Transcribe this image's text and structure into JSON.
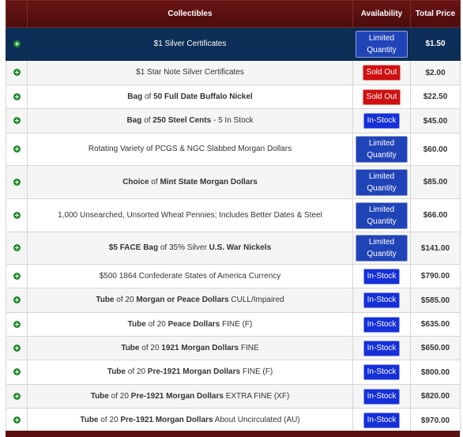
{
  "colors": {
    "header_bg": "#5b1010",
    "highlight_row": "#0d2e57",
    "plus_icon": "#1f8a2a",
    "limited_badge": "#2044b8",
    "sold_out_badge": "#d01010",
    "in_stock_badge": "#1530d8"
  },
  "table": {
    "headers": {
      "collectibles": "Collectibles",
      "availability": "Availability",
      "total_price": "Total Price"
    },
    "rows": [
      {
        "parts": [
          {
            "t": "$1 Silver Certificates",
            "b": false
          }
        ],
        "status": "Limited Quantity",
        "kind": "lim",
        "price": "$1.50",
        "hl": true
      },
      {
        "parts": [
          {
            "t": "$1 Star Note Silver Certificates",
            "b": false
          }
        ],
        "status": "Sold Out",
        "kind": "sold",
        "price": "$2.00"
      },
      {
        "parts": [
          {
            "t": "Bag",
            "b": true
          },
          {
            "t": " of ",
            "b": false
          },
          {
            "t": "50 Full Date Buffalo Nickel",
            "b": true
          }
        ],
        "status": "Sold Out",
        "kind": "sold",
        "price": "$22.50"
      },
      {
        "parts": [
          {
            "t": "Bag",
            "b": true
          },
          {
            "t": " of ",
            "b": false
          },
          {
            "t": "250 Steel Cents",
            "b": true
          },
          {
            "t": " - 5 In Stock",
            "b": false
          }
        ],
        "status": "In-Stock",
        "kind": "in",
        "price": "$45.00"
      },
      {
        "parts": [
          {
            "t": "Rotating Variety of PCGS & NGC Slabbed Morgan Dollars",
            "b": false
          }
        ],
        "status": "Limited Quantity",
        "kind": "lim",
        "price": "$60.00"
      },
      {
        "parts": [
          {
            "t": "Choice",
            "b": true
          },
          {
            "t": " of ",
            "b": false
          },
          {
            "t": "Mint State Morgan Dollars",
            "b": true
          }
        ],
        "status": "Limited Quantity",
        "kind": "lim",
        "price": "$85.00"
      },
      {
        "parts": [
          {
            "t": "1,000 Unsearched, Unsorted Wheat Pennies; Includes Better Dates & Steel",
            "b": false
          }
        ],
        "status": "Limited Quantity",
        "kind": "lim",
        "price": "$66.00"
      },
      {
        "parts": [
          {
            "t": "$5 FACE Bag",
            "b": true
          },
          {
            "t": " of ",
            "b": false
          },
          {
            "t": "35%",
            "b": false
          },
          {
            "t": " Silver ",
            "b": false
          },
          {
            "t": "U.S. War Nickels",
            "b": true
          }
        ],
        "status": "Limited Quantity",
        "kind": "lim",
        "price": "$141.00"
      },
      {
        "parts": [
          {
            "t": "$500 1864 Confederate States of America Currency",
            "b": false
          }
        ],
        "status": "In-Stock",
        "kind": "in",
        "price": "$790.00"
      },
      {
        "parts": [
          {
            "t": "Tube",
            "b": true
          },
          {
            "t": " of 20 ",
            "b": false
          },
          {
            "t": "Morgan or Peace Dollars",
            "b": true
          },
          {
            "t": " CULL/Impaired",
            "b": false
          }
        ],
        "status": "In-Stock",
        "kind": "in",
        "price": "$585.00"
      },
      {
        "parts": [
          {
            "t": "Tube",
            "b": true
          },
          {
            "t": " of 20 ",
            "b": false
          },
          {
            "t": "Peace Dollars",
            "b": true
          },
          {
            "t": " FINE (F)",
            "b": false
          }
        ],
        "status": "In-Stock",
        "kind": "in",
        "price": "$635.00"
      },
      {
        "parts": [
          {
            "t": "Tube",
            "b": true
          },
          {
            "t": " of 20 ",
            "b": false
          },
          {
            "t": "1921 Morgan Dollars",
            "b": true
          },
          {
            "t": " FINE",
            "b": false
          }
        ],
        "status": "In-Stock",
        "kind": "in",
        "price": "$650.00"
      },
      {
        "parts": [
          {
            "t": "Tube",
            "b": true
          },
          {
            "t": " of 20 ",
            "b": false
          },
          {
            "t": "Pre-1921 Morgan Dollars",
            "b": true
          },
          {
            "t": " FINE (F)",
            "b": false
          }
        ],
        "status": "In-Stock",
        "kind": "in",
        "price": "$800.00"
      },
      {
        "parts": [
          {
            "t": "Tube",
            "b": true
          },
          {
            "t": " of 20 ",
            "b": false
          },
          {
            "t": "Pre-1921 Morgan Dollars",
            "b": true
          },
          {
            "t": " EXTRA FINE (XF)",
            "b": false
          }
        ],
        "status": "In-Stock",
        "kind": "in",
        "price": "$820.00"
      },
      {
        "parts": [
          {
            "t": "Tube",
            "b": true
          },
          {
            "t": " of 20 ",
            "b": false
          },
          {
            "t": "Pre-1921 Morgan Dollars",
            "b": true
          },
          {
            "t": " About Uncirculated (AU)",
            "b": false
          }
        ],
        "status": "In-Stock",
        "kind": "in",
        "price": "$970.00"
      }
    ]
  }
}
